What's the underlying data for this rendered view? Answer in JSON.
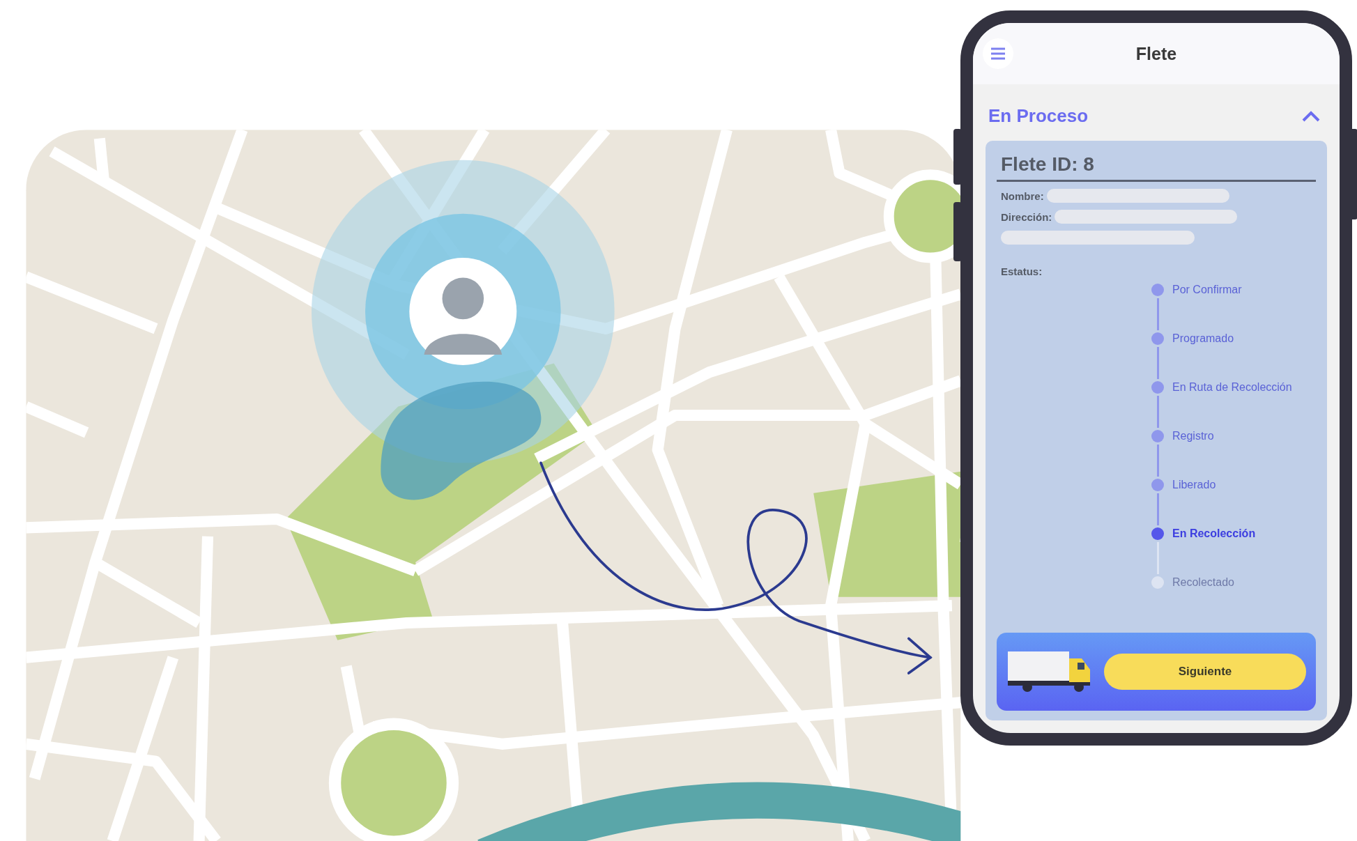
{
  "phone": {
    "title": "Flete",
    "section": {
      "title": "En Proceso",
      "expanded": true
    },
    "card": {
      "title": "Flete ID: 8",
      "fields": [
        {
          "label": "Nombre:",
          "kind": "single"
        },
        {
          "label": "Dirección:",
          "kind": "double"
        }
      ],
      "status_label": "Estatus:",
      "steps": [
        {
          "label": "Por Confirmar",
          "done": true,
          "selected": false
        },
        {
          "label": "Programado",
          "done": true,
          "selected": false
        },
        {
          "label": "En Ruta de Recolección",
          "done": true,
          "selected": false
        },
        {
          "label": "Registro",
          "done": true,
          "selected": false
        },
        {
          "label": "Liberado",
          "done": true,
          "selected": false
        },
        {
          "label": "En Recolección",
          "done": false,
          "selected": true
        },
        {
          "label": "Recolectado",
          "done": false,
          "selected": false
        }
      ]
    },
    "action": {
      "label": "Siguiente"
    }
  }
}
